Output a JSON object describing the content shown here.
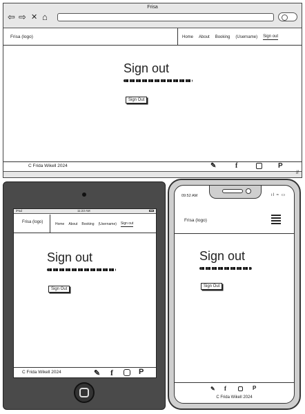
{
  "browser": {
    "title": "Frisa",
    "nav_glyphs": [
      "⇦",
      "⇨",
      "✕",
      "⌂"
    ]
  },
  "site": {
    "logo": "Frisa (logo)",
    "nav": [
      "Home",
      "About",
      "Booking",
      "(Username)",
      "Sign out"
    ],
    "active_nav": "Sign out",
    "heading": "Sign out",
    "button": "Sign Out",
    "footer_text": "C Frida Wikell 2024",
    "social_icons": [
      "edit-icon",
      "facebook-icon",
      "instagram-icon",
      "pinterest-icon"
    ]
  },
  "tablet": {
    "status_left": "iPad",
    "status_time": "11:23 AM"
  },
  "phone": {
    "status_time": "09:52 AM"
  }
}
